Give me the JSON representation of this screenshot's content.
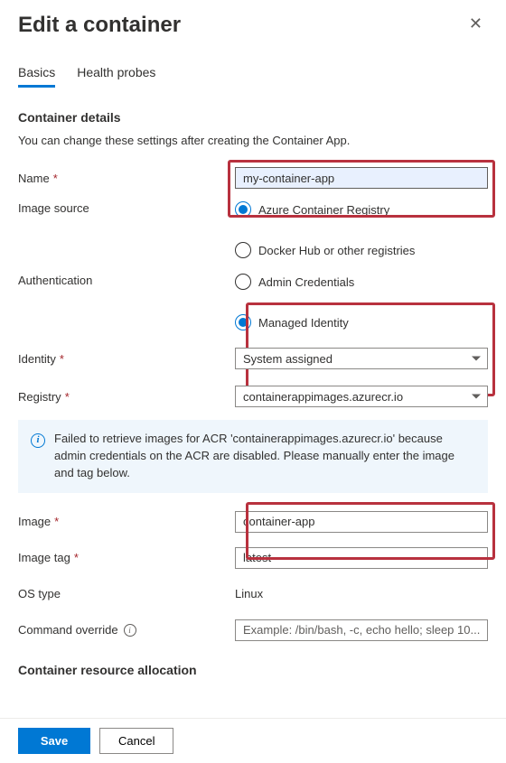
{
  "panel": {
    "title": "Edit a container"
  },
  "tabs": [
    {
      "label": "Basics",
      "active": true
    },
    {
      "label": "Health probes",
      "active": false
    }
  ],
  "sections": {
    "container_details": {
      "title": "Container details",
      "description": "You can change these settings after creating the Container App."
    },
    "resource_allocation": {
      "title": "Container resource allocation"
    }
  },
  "fields": {
    "name": {
      "label": "Name",
      "required": true,
      "value": "my-container-app"
    },
    "image_source": {
      "label": "Image source",
      "options": [
        "Azure Container Registry",
        "Docker Hub or other registries"
      ],
      "selected_index": 0
    },
    "authentication": {
      "label": "Authentication",
      "options": [
        "Admin Credentials",
        "Managed Identity"
      ],
      "selected_index": 1
    },
    "identity": {
      "label": "Identity",
      "required": true,
      "value": "System assigned"
    },
    "registry": {
      "label": "Registry",
      "required": true,
      "value": "containerappimages.azurecr.io"
    },
    "image": {
      "label": "Image",
      "required": true,
      "value": "container-app"
    },
    "image_tag": {
      "label": "Image tag",
      "required": true,
      "value": "latest"
    },
    "os_type": {
      "label": "OS type",
      "value": "Linux"
    },
    "command_override": {
      "label": "Command override",
      "placeholder": "Example: /bin/bash, -c, echo hello; sleep 10..."
    }
  },
  "info_message": "Failed to retrieve images for ACR 'containerappimages.azurecr.io' because admin credentials on the ACR are disabled. Please manually enter the image and tag below.",
  "footer": {
    "save": "Save",
    "cancel": "Cancel"
  }
}
